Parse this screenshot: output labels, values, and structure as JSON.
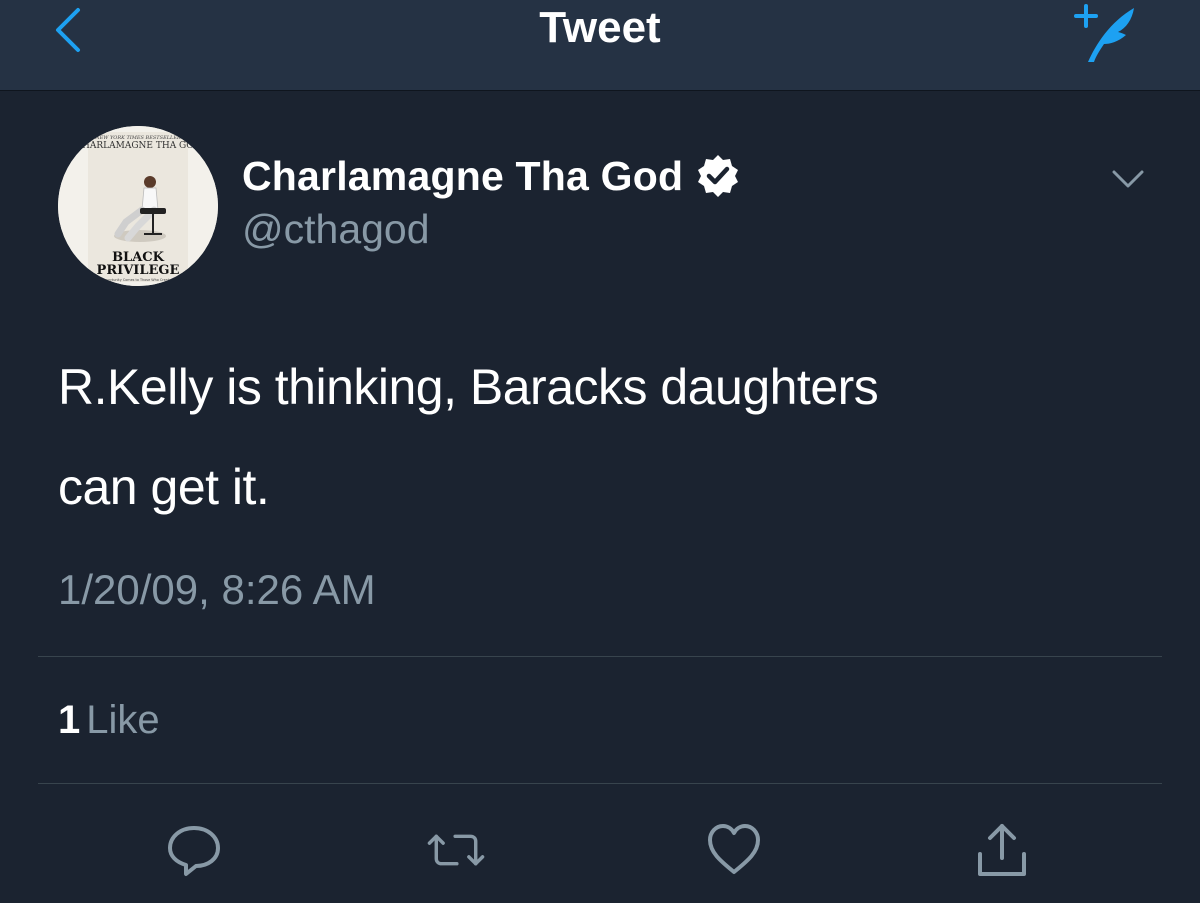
{
  "nav": {
    "title": "Tweet",
    "back_icon": "chevron-left-icon",
    "compose_icon": "compose-tweet-icon",
    "accent_color": "#1da1f2"
  },
  "tweet": {
    "author": {
      "name": "Charlamagne Tha God",
      "handle": "@cthagod",
      "verified": true,
      "avatar_text": {
        "top": "NEW YORK TIMES BESTSELLER",
        "author": "CHARLAMAGNE THA GOD",
        "title_line1": "BLACK",
        "title_line2": "PRIVILEGE",
        "tagline": "Opportunity Comes to Those Who Create It"
      }
    },
    "text_lines": [
      "R.Kelly is thinking, Baracks daughters",
      "can get it."
    ],
    "timestamp": "1/20/09, 8:26 AM",
    "likes": {
      "count": "1",
      "label": "Like"
    }
  },
  "actions": [
    "reply-icon",
    "retweet-icon",
    "like-icon",
    "share-icon"
  ]
}
